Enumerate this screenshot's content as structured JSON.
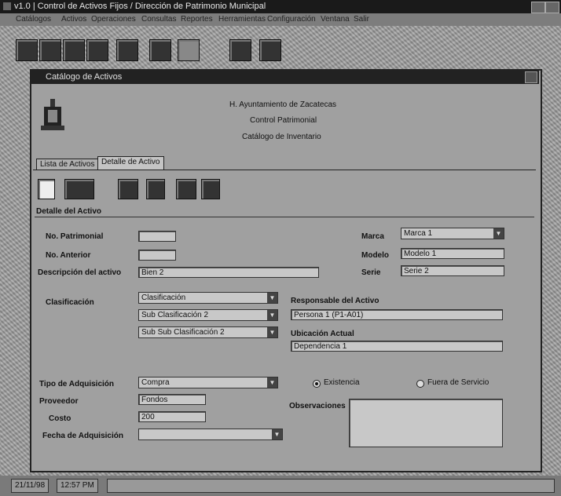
{
  "app": {
    "title": "v1.0 | Control de Activos Fijos / Dirección de Patrimonio Municipal"
  },
  "menu": {
    "items": [
      "Catálogos",
      "Activos",
      "Operaciones",
      "Consultas",
      "Reportes",
      "Herramientas",
      "Configuración",
      "Ventana",
      "Salir"
    ]
  },
  "toolbar": {
    "icons": [
      "grid-icon",
      "card-icon",
      "pen-icon",
      "refresh-icon",
      "tools-icon",
      "document-icon",
      "folder-icon",
      "hand-icon",
      "people-icon"
    ]
  },
  "child_window": {
    "title": "Catálogo de Activos",
    "header_lines": [
      "H. Ayuntamiento de Zacatecas",
      "Control Patrimonial",
      "Catálogo de Inventario"
    ],
    "tabs": [
      "Lista de Activos",
      "Detalle de Activo"
    ],
    "section_title": "Detalle del Activo",
    "form": {
      "no_patrimonial_label": "No. Patrimonial",
      "no_patrimonial_value": "",
      "no_anterior_label": "No. Anterior",
      "no_anterior_value": "",
      "descripcion_label": "Descripción del activo",
      "descripcion_value": "Bien 2",
      "marca_label": "Marca",
      "marca_value": "Marca 1",
      "modelo_label": "Modelo",
      "modelo_value": "Modelo 1",
      "serie_label": "Serie",
      "serie_value": "Serie 2",
      "clasificacion_label": "Clasificación",
      "clasificacion_value": "Clasificación",
      "subclasificacion_value": "Sub Clasificación 2",
      "subsubclasificacion_value": "Sub Sub Clasificación 2",
      "responsable_label": "Responsable del Activo",
      "responsable_value": "Persona 1 (P1-A01)",
      "ubicacion_label": "Ubicación Actual",
      "ubicacion_value": "Dependencia 1",
      "tipo_adquisicion_label": "Tipo de Adquisición",
      "tipo_adquisicion_value": "Compra",
      "radio_1_label": "Existencia",
      "radio_2_label": "Fuera de Servicio",
      "radio_selected": "Existencia",
      "proveedor_label": "Proveedor",
      "proveedor_value": "Fondos",
      "costo_label": "Costo",
      "costo_value": "200",
      "fecha_adquisicion_label": "Fecha de Adquisición",
      "fecha_adquisicion_value": "",
      "observaciones_label": "Observaciones"
    }
  },
  "status": {
    "date": "21/11/98",
    "time": "12:57 PM"
  }
}
